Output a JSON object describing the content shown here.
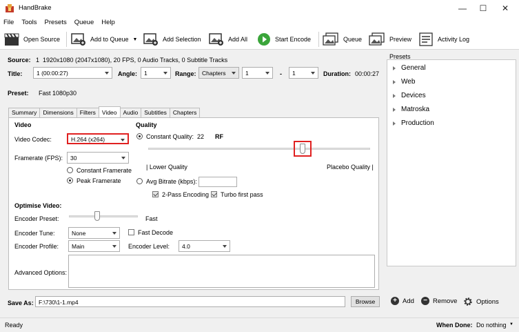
{
  "window": {
    "title": "HandBrake",
    "minimize": "—",
    "maximize": "☐",
    "close": "✕"
  },
  "menu": [
    "File",
    "Tools",
    "Presets",
    "Queue",
    "Help"
  ],
  "toolbar": {
    "open_source": "Open Source",
    "add_to_queue": "Add to Queue",
    "add_selection": "Add Selection",
    "add_all": "Add All",
    "start_encode": "Start Encode",
    "queue": "Queue",
    "preview": "Preview",
    "activity_log": "Activity Log"
  },
  "source": {
    "label": "Source:",
    "index": "1",
    "info": "1920x1080 (2047x1080), 20 FPS, 0 Audio Tracks, 0 Subtitle Tracks"
  },
  "title_row": {
    "title_label": "Title:",
    "title_value": "1 (00:00:27)",
    "angle_label": "Angle:",
    "angle_value": "1",
    "range_label": "Range:",
    "range_mode": "Chapters",
    "range_start": "1",
    "range_sep": "-",
    "range_end": "1",
    "duration_label": "Duration:",
    "duration_value": "00:00:27"
  },
  "preset": {
    "label": "Preset:",
    "value": "Fast 1080p30"
  },
  "tabs": [
    "Summary",
    "Dimensions",
    "Filters",
    "Video",
    "Audio",
    "Subtitles",
    "Chapters"
  ],
  "video": {
    "section": "Video",
    "codec_label": "Video Codec:",
    "codec_value": "H.264 (x264)",
    "framerate_label": "Framerate (FPS):",
    "framerate_value": "30",
    "constant_framerate": "Constant Framerate",
    "peak_framerate": "Peak Framerate"
  },
  "quality": {
    "section": "Quality",
    "constant_quality": "Constant Quality:",
    "cq_value": "22",
    "cq_unit": "RF",
    "slider_level": 0.7,
    "lower_label": "| Lower Quality",
    "higher_label": "Placebo Quality |",
    "avg_bitrate": "Avg Bitrate (kbps):",
    "two_pass": "2-Pass Encoding",
    "turbo": "Turbo first pass"
  },
  "optimise": {
    "section": "Optimise Video:",
    "preset_label": "Encoder Preset:",
    "preset_value": "Fast",
    "preset_level": 0.4,
    "tune_label": "Encoder Tune:",
    "tune_value": "None",
    "fast_decode": "Fast Decode",
    "profile_label": "Encoder Profile:",
    "profile_value": "Main",
    "level_label": "Encoder Level:",
    "level_value": "4.0",
    "advanced_label": "Advanced Options:"
  },
  "save": {
    "label": "Save As:",
    "path": "F:\\730\\1-1.mp4",
    "browse": "Browse"
  },
  "presets_panel": {
    "header": "Presets",
    "items": [
      "General",
      "Web",
      "Devices",
      "Matroska",
      "Production"
    ],
    "add": "Add",
    "remove": "Remove",
    "options": "Options"
  },
  "status": {
    "text": "Ready",
    "when_done_label": "When Done:",
    "when_done_value": "Do nothing"
  },
  "colors": {
    "start_green": "#3aa53a",
    "highlight_red": "#e02020"
  }
}
